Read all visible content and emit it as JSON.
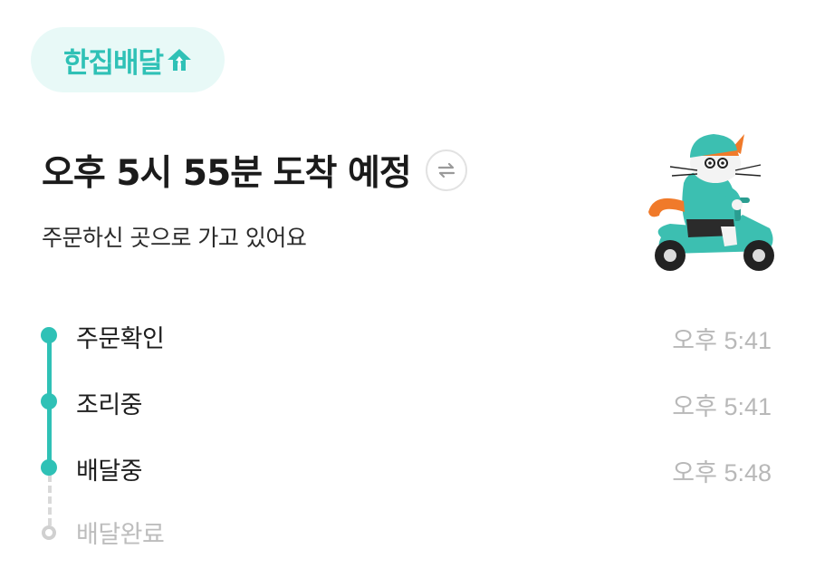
{
  "badge": {
    "label": "한집배달",
    "icon": "home-arrow-icon"
  },
  "header": {
    "title": "오후 5시 55분 도착 예정",
    "subtitle": "주문하신 곳으로 가고 있어요"
  },
  "steps": [
    {
      "label": "주문확인",
      "time": "오후 5:41",
      "status": "done"
    },
    {
      "label": "조리중",
      "time": "오후 5:41",
      "status": "done"
    },
    {
      "label": "배달중",
      "time": "오후 5:48",
      "status": "current"
    },
    {
      "label": "배달완료",
      "time": "",
      "status": "pending"
    }
  ],
  "colors": {
    "accent": "#2fc1b6",
    "badge_bg": "#e8f9f7",
    "muted": "#b8b8b8"
  }
}
